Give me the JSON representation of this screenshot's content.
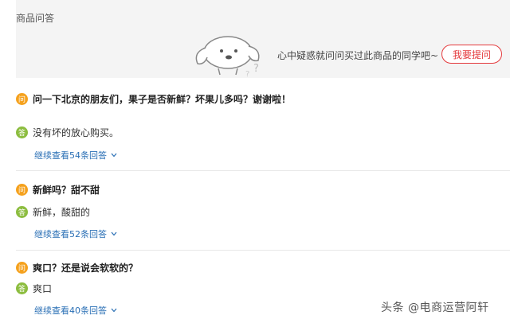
{
  "header": {
    "title": "商品问答",
    "prompt": "心中疑惑就问问买过此商品的同学吧~",
    "ask_button": "我要提问"
  },
  "badges": {
    "question": "问",
    "answer": "答"
  },
  "qa": [
    {
      "question": "问一下北京的朋友们，果子是否新鲜？坏果儿多吗？谢谢啦！",
      "answer": "没有坏的放心购买。",
      "more": "继续查看54条回答"
    },
    {
      "question": "新鲜吗？甜不甜",
      "answer": "新鲜，酸甜的",
      "more": "继续查看52条回答"
    },
    {
      "question": "爽口？还是说会软软的？",
      "answer": "爽口",
      "more": "继续查看40条回答"
    }
  ],
  "watermark": "头条 @电商运营阿轩",
  "colors": {
    "question_badge": "#f5a11d",
    "answer_badge": "#8cbd3f",
    "link": "#2a6fb5",
    "accent": "#e4393c"
  }
}
